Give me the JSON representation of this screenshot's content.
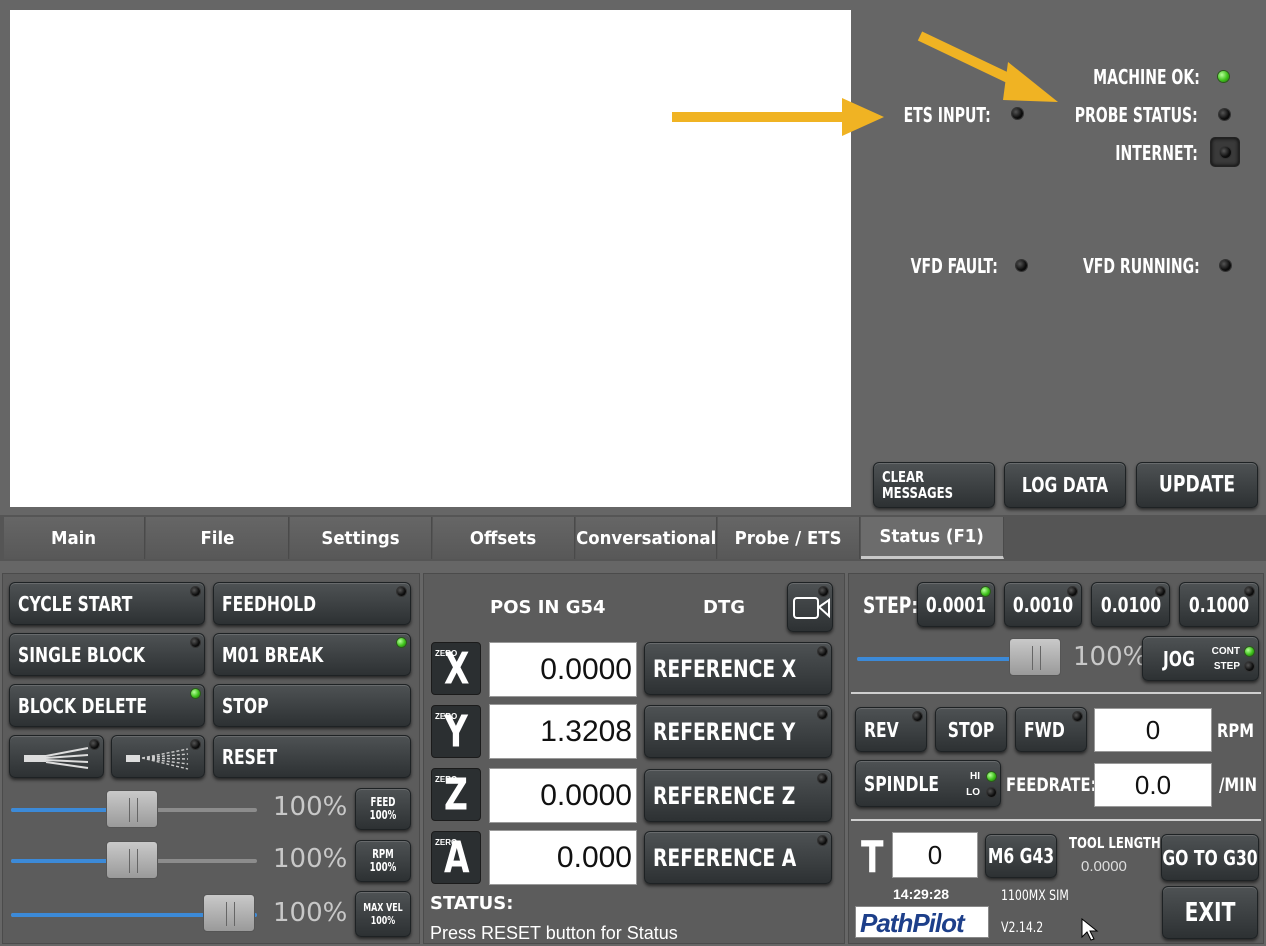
{
  "status_panel": {
    "machine_ok": "MACHINE OK:",
    "ets_input": "ETS INPUT:",
    "probe_status": "PROBE STATUS:",
    "internet": "INTERNET:",
    "vfd_fault": "VFD FAULT:",
    "vfd_running": "VFD RUNNING:",
    "clear_messages": "CLEAR\nMESSAGES",
    "log_data": "LOG DATA",
    "update": "UPDATE"
  },
  "tabs": [
    "Main",
    "File",
    "Settings",
    "Offsets",
    "Conversational",
    "Probe / ETS",
    "Status (F1)"
  ],
  "left_panel": {
    "cycle_start": "CYCLE START",
    "feedhold": "FEEDHOLD",
    "single_block": "SINGLE BLOCK",
    "m01_break": "M01 BREAK",
    "block_delete": "BLOCK DELETE",
    "stop": "STOP",
    "reset": "RESET",
    "feed_pct": "100%",
    "rpm_pct": "100%",
    "maxvel_pct": "100%",
    "feed_btn": "FEED\n100%",
    "rpm_btn": "RPM\n100%",
    "maxvel_btn": "MAX VEL\n100%",
    "feed_override": 0.5,
    "rpm_override": 0.5,
    "maxvel_override": 1.0
  },
  "dro": {
    "pos_header": "POS IN G54",
    "dtg_header": "DTG",
    "zero_text": "ZERO",
    "axes": [
      {
        "letter": "X",
        "value": "0.0000",
        "ref": "REFERENCE  X"
      },
      {
        "letter": "Y",
        "value": "1.3208",
        "ref": "REFERENCE  Y"
      },
      {
        "letter": "Z",
        "value": "0.0000",
        "ref": "REFERENCE  Z"
      },
      {
        "letter": "A",
        "value": "0.000",
        "ref": "REFERENCE  A"
      }
    ],
    "status_label": "STATUS:",
    "status_text": "Press RESET button for Status"
  },
  "right_panel": {
    "step_label": "STEP:",
    "steps": [
      "0.0001",
      "0.0010",
      "0.0100",
      "0.1000"
    ],
    "jog_pct": "100%",
    "jog_speed": 1.0,
    "jog": "JOG",
    "cont": "CONT",
    "step": "STEP",
    "rev": "REV",
    "stop": "STOP",
    "fwd": "FWD",
    "rpm_value": "0",
    "rpm_unit": "RPM",
    "spindle": "SPINDLE",
    "hi": "HI",
    "lo": "LO",
    "feedrate_label": "FEEDRATE:",
    "feedrate_value": "0.0",
    "feedrate_unit": "/MIN",
    "tool_label": "T",
    "tool_value": "0",
    "m6g43": "M6 G43",
    "tool_length_label": "TOOL LENGTH",
    "tool_length_value": "0.0000",
    "go_to_g30": "GO TO G30",
    "time": "14:29:28",
    "machine": "1100MX SIM",
    "version": "V2.14.2",
    "logo": "PathPilot",
    "exit": "EXIT"
  },
  "colors": {
    "led_on": "#3ec21a",
    "accent": "#f0b323",
    "slider_fill": "#3c8ad8"
  }
}
